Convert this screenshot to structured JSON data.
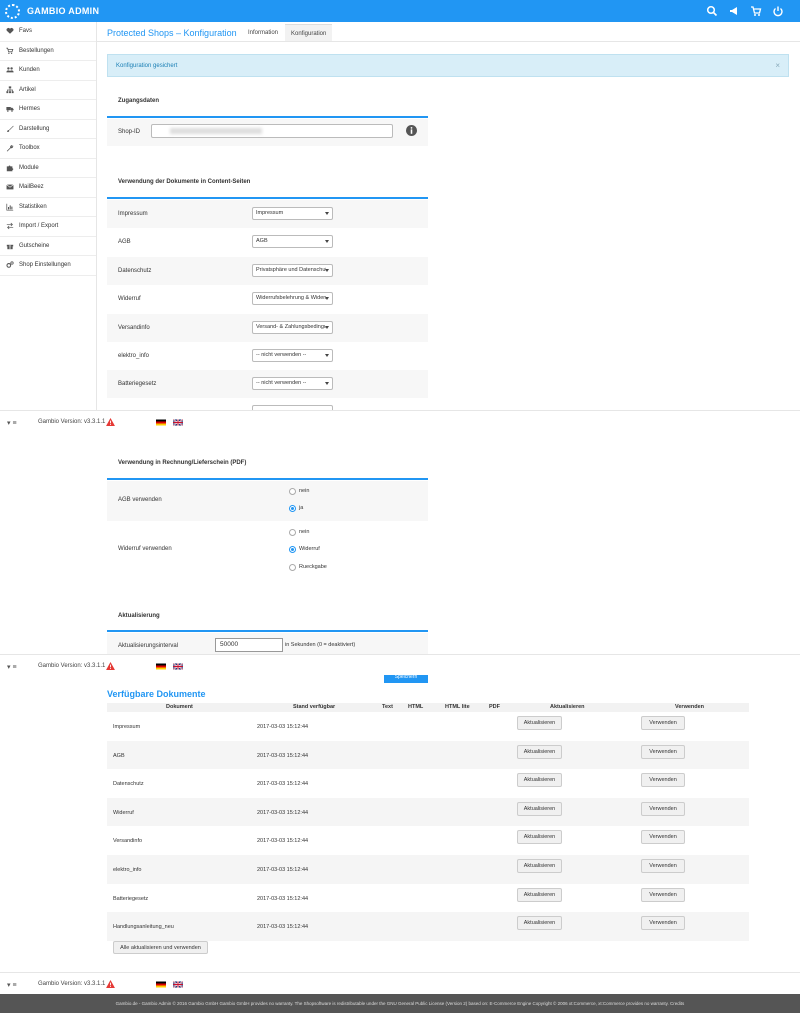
{
  "topbar": {
    "brand": "GAMBIO ADMIN"
  },
  "sidebar": {
    "items": [
      {
        "label": "Favs",
        "icon": "heart-icon"
      },
      {
        "label": "Bestellungen",
        "icon": "cart-icon"
      },
      {
        "label": "Kunden",
        "icon": "users-icon"
      },
      {
        "label": "Artikel",
        "icon": "sitemap-icon"
      },
      {
        "label": "Hermes",
        "icon": "truck-icon"
      },
      {
        "label": "Darstellung",
        "icon": "brush-icon"
      },
      {
        "label": "Toolbox",
        "icon": "wrench-icon"
      },
      {
        "label": "Module",
        "icon": "puzzle-icon"
      },
      {
        "label": "MailBeez",
        "icon": "envelope-icon"
      },
      {
        "label": "Statistiken",
        "icon": "chart-icon"
      },
      {
        "label": "Import / Export",
        "icon": "exchange-icon"
      },
      {
        "label": "Gutscheine",
        "icon": "gift-icon"
      },
      {
        "label": "Shop Einstellungen",
        "icon": "cogs-icon"
      }
    ]
  },
  "page": {
    "title": "Protected Shops – Konfiguration",
    "tabs": [
      "Information",
      "Konfiguration"
    ],
    "active_tab": "Konfiguration"
  },
  "alert": {
    "text": "Konfiguration gesichert",
    "close": "×"
  },
  "zugangsdaten": {
    "title": "Zugangsdaten",
    "shop_id_label": "Shop-ID"
  },
  "content_pages": {
    "title": "Verwendung der Dokumente in Content-Seiten",
    "rows": [
      {
        "label": "Impressum",
        "value": "Impressum"
      },
      {
        "label": "AGB",
        "value": "AGB"
      },
      {
        "label": "Datenschutz",
        "value": "Privatsphäre und Datenschutz"
      },
      {
        "label": "Widerruf",
        "value": "Widerrufsbelehrung & Widerrufsformular"
      },
      {
        "label": "Versandinfo",
        "value": "Versand- & Zahlungsbedingungen"
      },
      {
        "label": "elektro_info",
        "value": "-- nicht verwenden --"
      },
      {
        "label": "Batteriegesetz",
        "value": "-- nicht verwenden --"
      }
    ]
  },
  "footer": {
    "version": "Gambio Version: v3.3.1.1",
    "menu": "▾ ≡"
  },
  "pdf": {
    "title": "Verwendung in Rechnung/Lieferschein (PDF)",
    "agb": {
      "label": "AGB verwenden",
      "options": [
        "nein",
        "ja"
      ],
      "selected": "ja"
    },
    "widerruf": {
      "label": "Widerruf verwenden",
      "options": [
        "nein",
        "Widerruf",
        "Rueckgabe"
      ],
      "selected": "Widerruf"
    }
  },
  "aktualisierung": {
    "title": "Aktualisierung",
    "interval_label": "Aktualisierungsinterval",
    "interval_value": "50000",
    "interval_hint": "in Sekunden (0 = deaktiviert)",
    "save_button": "Speichern"
  },
  "documents": {
    "title": "Verfügbare Dokumente",
    "headers": [
      "Dokument",
      "Stand verfügbar",
      "Text",
      "HTML",
      "HTML lite",
      "PDF",
      "Aktualisieren",
      "Verwenden"
    ],
    "rows": [
      {
        "name": "Impressum",
        "date": "2017-03-03 15:12:44"
      },
      {
        "name": "AGB",
        "date": "2017-03-03 15:12:44"
      },
      {
        "name": "Datenschutz",
        "date": "2017-03-03 15:12:44"
      },
      {
        "name": "Widerruf",
        "date": "2017-03-03 15:12:44"
      },
      {
        "name": "Versandinfo",
        "date": "2017-03-03 15:12:44"
      },
      {
        "name": "elektro_info",
        "date": "2017-03-03 15:12:44"
      },
      {
        "name": "Batteriegesetz",
        "date": "2017-03-03 15:12:44"
      },
      {
        "name": "Handlungsanleitung_neu",
        "date": "2017-03-03 15:12:44"
      }
    ],
    "update_label": "Aktualisieren",
    "use_label": "Verwenden",
    "update_all": "Alle aktualisieren und verwenden"
  },
  "copyright": {
    "text": "Gambio.de - Gambio Admin © 2016 Gambio GmbH Gambio GmbH provides no warranty. The Shopsoftware is redistributable under the GNU General Public License (Version 2) based on: E-Commerce Engine Copyright © 2006 xt:Commerce, xt:Commerce provides no warranty.  Credits"
  },
  "colors": {
    "accent": "#2196f3",
    "warning": "#e53935"
  }
}
